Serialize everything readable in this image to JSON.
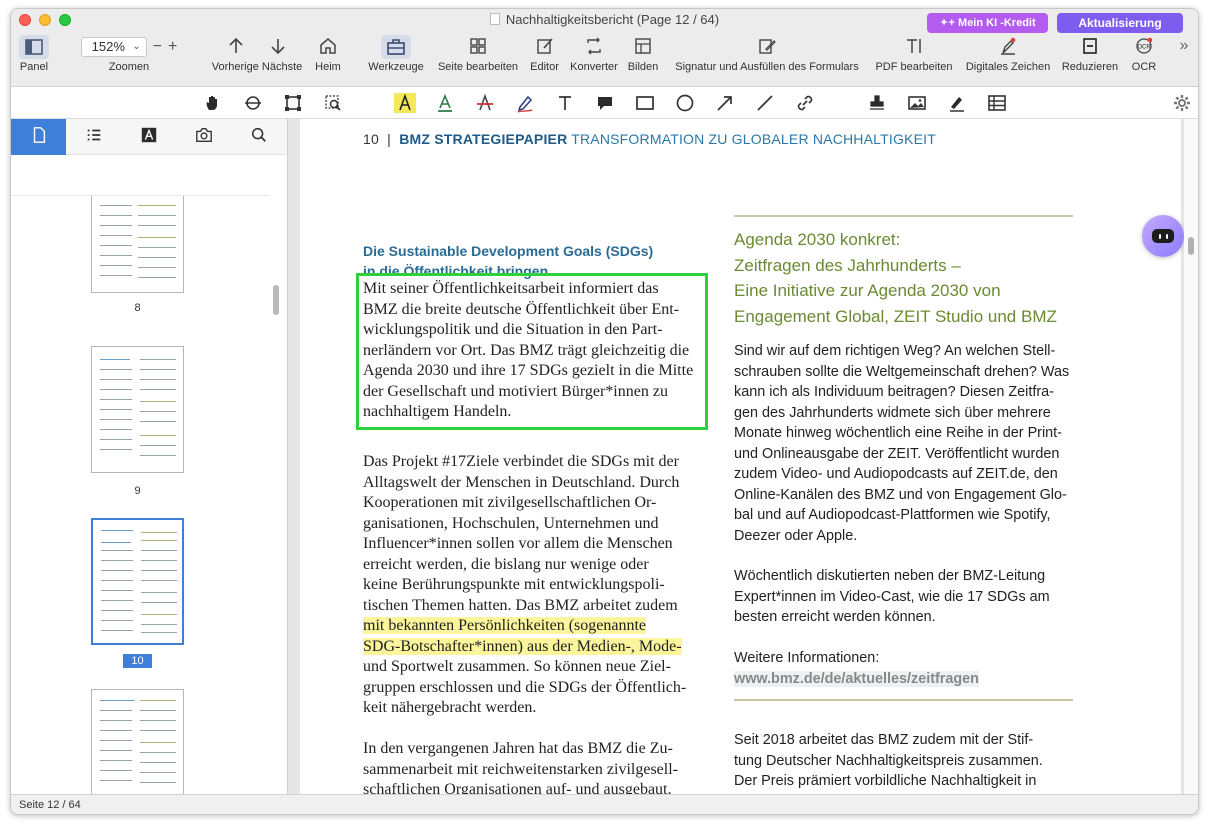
{
  "window": {
    "title": "Nachhaltigkeitsbericht (Page 12 / 64)",
    "ai_credit_label": "Mein KI -Kredit",
    "upgrade_label": "Aktualisierung"
  },
  "toolbar": {
    "panel": "Panel",
    "zoom_value": "152%",
    "zoom_label": "Zoomen",
    "prev_next": "Vorherige Nächste",
    "home": "Heim",
    "tools": "Werkzeuge",
    "edit_page": "Seite bearbeiten",
    "editor": "Editor",
    "converter": "Konverter",
    "images": "Bilden",
    "sign_fill": "Signatur und Ausfüllen des Formulars",
    "pdf_edit": "PDF bearbeiten",
    "digital_sign": "Digitales Zeichen",
    "reduce": "Reduzieren",
    "ocr": "OCR",
    "more": "»"
  },
  "annotation_tools": [
    "hand-icon",
    "select-text-icon",
    "area-select-icon",
    "zoom-area-icon",
    "highlight-icon",
    "underline-icon",
    "strikethrough-icon",
    "pen-icon",
    "text-icon",
    "comment-icon",
    "rectangle-icon",
    "circle-icon",
    "arrow-icon",
    "line-icon",
    "link-icon",
    "stamp-icon",
    "image-icon",
    "signature-icon",
    "table-icon"
  ],
  "sidebar": {
    "tabs": [
      "thumbnails-icon",
      "outline-icon",
      "text-icon",
      "camera-icon",
      "search-icon"
    ],
    "pages": [
      "8",
      "9",
      "10"
    ],
    "selected_page": "10"
  },
  "document": {
    "running_head_num": "10",
    "running_head_sep": "|",
    "running_head_strong": "BMZ STRATEGIEPAPIER",
    "running_head_light": "TRANSFORMATION ZU GLOBALER NACHHALTIGKEIT",
    "left_heading_1": "Die Sustainable Development Goals (SDGs)",
    "left_heading_2": "in die Öffentlichkeit bringen",
    "left_p1": [
      "Mit seiner Öffentlichkeitsarbeit informiert das",
      "BMZ die breite deutsche Öffentlichkeit über Ent-",
      "wicklungspolitik und die Situation in den Part-",
      "nerländern vor Ort. Das BMZ trägt gleichzeitig die",
      "Agenda 2030 und ihre 17 SDGs gezielt in die Mitte",
      "der Gesellschaft und motiviert Bürger*innen zu",
      "nachhaltigem Handeln."
    ],
    "left_p2": [
      "Das Projekt #17Ziele verbindet die SDGs mit der",
      "Alltagswelt der Menschen in Deutschland. Durch",
      "Kooperationen mit zivilgesellschaftlichen Or-",
      "ganisationen, Hochschulen, Unternehmen und",
      "Influencer*innen sollen vor allem die Menschen",
      "erreicht werden, die bislang nur wenige oder",
      "keine Berührungspunkte mit entwicklungspoli-",
      "tischen Themen hatten. Das BMZ arbeitet zudem",
      "mit bekannten Persönlichkeiten (sogenannte",
      "SDG-Botschafter*innen) aus der Medien-, Mode-",
      "und Sportwelt zusammen. So können neue Ziel-",
      "gruppen erschlossen und die SDGs der Öffentlich-",
      "keit nähergebracht werden."
    ],
    "left_p3": [
      "In den vergangenen Jahren hat das BMZ die Zu-",
      "sammenarbeit mit reichweitenstarken zivilgesell-",
      "schaftlichen Organisationen auf- und ausgebaut."
    ],
    "right_title": [
      "Agenda 2030 konkret:",
      "Zeitfragen des Jahrhunderts –",
      "Eine Initiative zur Agenda 2030 von",
      "Engagement Global, ZEIT Studio und BMZ"
    ],
    "right_p1": [
      "Sind wir auf dem richtigen Weg? An welchen Stell-",
      "schrauben sollte die Weltgemeinschaft drehen? Was",
      "kann ich als Individuum beitragen? Diesen Zeitfra-",
      "gen des Jahrhunderts widmete sich über mehrere",
      "Monate hinweg wöchentlich eine Reihe in der Print-",
      "und Onlineausgabe der ZEIT. Veröffentlicht wurden",
      "zudem Video- und Audiopodcasts auf ZEIT.de, den",
      "Online-Kanälen des BMZ und von Engagement Glo-",
      "bal und auf Audiopodcast-Plattformen wie Spotify,",
      "Deezer oder Apple."
    ],
    "right_p2": [
      "Wöchentlich diskutierten neben der BMZ-Leitung",
      "Expert*innen im Video-Cast, wie die 17 SDGs am",
      "besten erreicht werden können."
    ],
    "right_p3_label": "Weitere Informationen:",
    "right_p3_link": "www.bmz.de/de/aktuelles/zeitfragen",
    "right_p4": [
      "Seit 2018 arbeitet das BMZ zudem mit der Stif-",
      "tung Deutscher Nachhaltigkeitspreis zusammen.",
      "Der Preis prämiert vorbildliche Nachhaltigkeit in"
    ]
  },
  "status": {
    "page_indicator": "Seite 12 / 64"
  },
  "colors": {
    "accent": "#3d7fd9",
    "selection_box": "#2ed13a",
    "highlight": "#fbf59b",
    "agenda_green": "#6b8a33",
    "heading_blue": "#2a6b96"
  }
}
